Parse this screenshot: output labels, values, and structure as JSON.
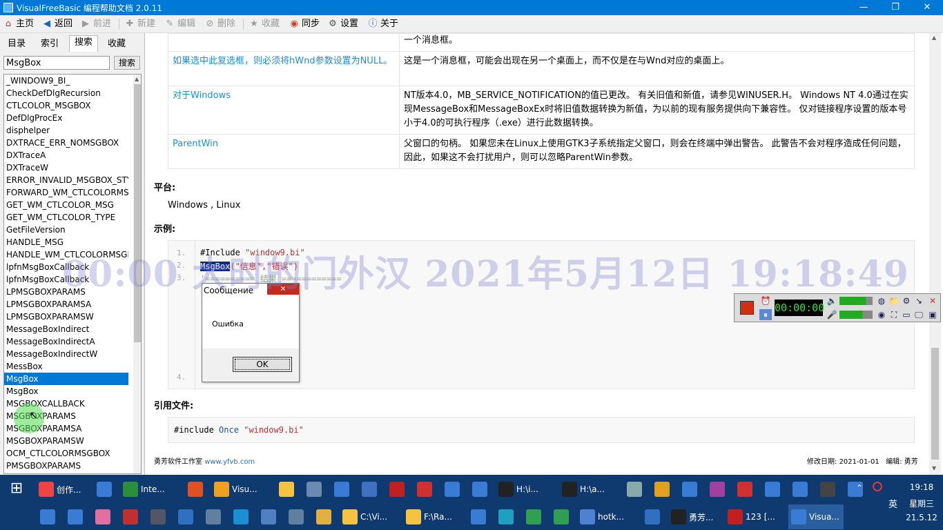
{
  "window": {
    "title": "VisualFreeBasic 编程帮助文档 2.0.11",
    "min": "—",
    "max": "❐",
    "close": "✕"
  },
  "toolbar": {
    "home": "主页",
    "back": "返回",
    "forward": "前进",
    "new": "新建",
    "edit": "编辑",
    "delete": "删除",
    "favorite": "收藏",
    "sync": "同步",
    "settings": "设置",
    "about": "关于"
  },
  "tabs": [
    "目录",
    "索引",
    "搜索",
    "收藏"
  ],
  "search": {
    "value": "MsgBox",
    "button": "搜索"
  },
  "results": [
    "_WINDOW9_BI_",
    "CheckDefDlgRecursion",
    "CTLCOLOR_MSGBOX",
    "DefDlgProcEx",
    "disphelper",
    "DXTRACE_ERR_NOMSGBOX",
    "DXTraceA",
    "DXTraceW",
    "ERROR_INVALID_MSGBOX_STYLE",
    "FORWARD_WM_CTLCOLORMSGBOX",
    "GET_WM_CTLCOLOR_MSG",
    "GET_WM_CTLCOLOR_TYPE",
    "GetFileVersion",
    "HANDLE_MSG",
    "HANDLE_WM_CTLCOLORMSGBOX",
    "lpfnMsgBoxCallback",
    "lpfnMsgBoxCallback",
    "LPMSGBOXPARAMS",
    "LPMSGBOXPARAMSA",
    "LPMSGBOXPARAMSW",
    "MessageBoxIndirect",
    "MessageBoxIndirectA",
    "MessageBoxIndirectW",
    "MessBox",
    "MsgBox",
    "MsgBox",
    "MSGBOXCALLBACK",
    "MSGBOXPARAMS",
    "MSGBOXPARAMSA",
    "MSGBOXPARAMSW",
    "OCM_CTLCOLORMSGBOX",
    "PMSGBOXPARAMS"
  ],
  "selected_index": 24,
  "params": {
    "top_cont": "一个消息框。",
    "rows": [
      {
        "name": "如果选中此复选框，则必须将hWnd参数设置为NULL。",
        "desc": "这是一个消息框，可能会出现在另一个桌面上，而不仅是在与Wnd对应的桌面上。"
      },
      {
        "name": "对于Windows",
        "desc": "NT版本4.0，MB_SERVICE_NOTIFICATION的值已更改。 有关旧值和新值，请参见WINUSER.H。 Windows NT 4.0通过在实现MessageBox和MessageBoxEx时将旧值数据转换为新值，为以前的现有服务提供向下兼容性。 仅对链接程序设置的版本号小于4.0的可执行程序（.exe）进行此数据转换。"
      },
      {
        "name": "ParentWin",
        "desc": "父窗口的句柄。 如果您未在Linux上使用GTK3子系统指定父窗口，则会在终端中弹出警告。 此警告不会对程序造成任何问题，因此，如果这不会打扰用户，则可以忽略ParentWin参数。"
      }
    ]
  },
  "platform_label": "平台:",
  "platform_value": "Windows , Linux",
  "example_label": "示例:",
  "code": {
    "line1_a": "#Include ",
    "line1_b": "\"window9.bi\"",
    "line2_fn": "MsgBox",
    "line2_rest": "(\"信息\",\"错误\")",
    "line3": "'========== 结果 ============",
    "ln1": "1.",
    "ln2": "2.",
    "ln3": "3.",
    "ln4": "4."
  },
  "msgbox": {
    "title": "Сообщение",
    "text": "Ошибка",
    "ok": "OK",
    "close": "✕"
  },
  "include_label": "引用文件:",
  "include_code": {
    "a": "#include ",
    "b": "Once ",
    "c": "\"window9.bi\""
  },
  "footer": {
    "left": "勇芳软件工作室",
    "link": "www.yfvb.com",
    "modified_label": "修改日期:",
    "modified": "2021-01-01",
    "editor_label": "编辑:",
    "editor": "勇芳"
  },
  "watermark": "00:00 大时的门外汉 2021年5月12日 19:18:49",
  "recorder": {
    "time": "00:00:00"
  },
  "taskbar": {
    "row1": [
      {
        "label": "创作...",
        "icon": "chrome-icon",
        "color": "#e44"
      },
      {
        "label": "",
        "icon": "window-icon",
        "color": "#3a7bd5"
      },
      {
        "label": "Inte...",
        "icon": "globe-icon",
        "color": "#2b8f3a"
      },
      {
        "label": "",
        "icon": "record-icon",
        "color": "#e05020"
      },
      {
        "label": "Visu...",
        "icon": "search-icon",
        "color": "#f0a020"
      },
      {
        "label": "",
        "icon": "folder-icon",
        "color": "#f5c242"
      },
      {
        "label": "",
        "icon": "triangle-icon",
        "color": "#6a8ab0"
      },
      {
        "label": "",
        "icon": "window-icon",
        "color": "#3a7bd5"
      },
      {
        "label": "",
        "icon": "box-icon",
        "color": "#4070c0"
      },
      {
        "label": "",
        "icon": "ladybug-icon",
        "color": "#c02020"
      },
      {
        "label": "",
        "icon": "dot-icon",
        "color": "#d03030"
      },
      {
        "label": "",
        "icon": "window-icon",
        "color": "#3a7bd5"
      },
      {
        "label": "",
        "icon": "window-icon",
        "color": "#3a7bd5"
      },
      {
        "label": "H:\\i...",
        "icon": "7z-icon",
        "color": "#222"
      },
      {
        "label": "H:\\a...",
        "icon": "7z-icon",
        "color": "#222"
      },
      {
        "label": "",
        "icon": "monitor-icon",
        "color": "#8aa"
      },
      {
        "label": "",
        "icon": "ftp-icon",
        "color": "#e0a020"
      },
      {
        "label": "",
        "icon": "window-icon",
        "color": "#3a7bd5"
      },
      {
        "label": "",
        "icon": "nox-icon",
        "color": "#a040a0"
      },
      {
        "label": "",
        "icon": "app-icon",
        "color": "#d03030"
      },
      {
        "label": "",
        "icon": "window-icon",
        "color": "#3a7bd5"
      },
      {
        "label": "",
        "icon": "tool-icon",
        "color": "#3a7bd5"
      },
      {
        "label": "",
        "icon": "calendar-icon",
        "color": "#444"
      },
      {
        "label": "",
        "icon": "window-icon",
        "color": "#3a7bd5"
      }
    ],
    "row2": [
      {
        "label": "",
        "icon": "window-icon",
        "color": "#3a7bd5"
      },
      {
        "label": "",
        "icon": "window-icon",
        "color": "#3a7bd5"
      },
      {
        "label": "",
        "icon": "app-icon",
        "color": "#e070a0"
      },
      {
        "label": "",
        "icon": "eye-icon",
        "color": "#c03030"
      },
      {
        "label": "",
        "icon": "steam-icon",
        "color": "#556"
      },
      {
        "label": "",
        "icon": "diamond-icon",
        "color": "#3070c0"
      },
      {
        "label": "",
        "icon": "network-icon",
        "color": "#6080a0"
      },
      {
        "label": "",
        "icon": "ie-icon",
        "color": "#1a8fd1"
      },
      {
        "label": "",
        "icon": "globe-icon",
        "color": "#5080c0"
      },
      {
        "label": "",
        "icon": "r-icon",
        "color": "#6080a0"
      },
      {
        "label": "",
        "icon": "folder-search-icon",
        "color": "#e0b040"
      },
      {
        "label": "C:\\Vi...",
        "icon": "folder-icon",
        "color": "#f5c242"
      },
      {
        "label": "F:\\Ra...",
        "icon": "folder-icon",
        "color": "#f5c242"
      },
      {
        "label": "",
        "icon": "window-icon",
        "color": "#3a7bd5"
      },
      {
        "label": "",
        "icon": "circle-icon",
        "color": "#20a0c0"
      },
      {
        "label": "",
        "icon": "g-icon",
        "color": "#30a050"
      },
      {
        "label": "",
        "icon": "g-icon",
        "color": "#30a050"
      },
      {
        "label": "hotk...",
        "icon": "plane-icon",
        "color": "#5080d0"
      },
      {
        "label": "",
        "icon": "fish-icon",
        "color": "#3070c0"
      },
      {
        "label": "勇芳...",
        "icon": "terminal-icon",
        "color": "#222"
      },
      {
        "label": "123 [...",
        "icon": "fb-icon",
        "color": "#c02020"
      },
      {
        "label": "Visua...",
        "icon": "app-icon",
        "color": "#3a7bd5",
        "active": true
      }
    ],
    "tray": {
      "lang": "英",
      "weekday": "星期三",
      "up": "⌃"
    },
    "clock": {
      "time": "19:18",
      "date": "21.5.12"
    },
    "start": "⊞"
  }
}
